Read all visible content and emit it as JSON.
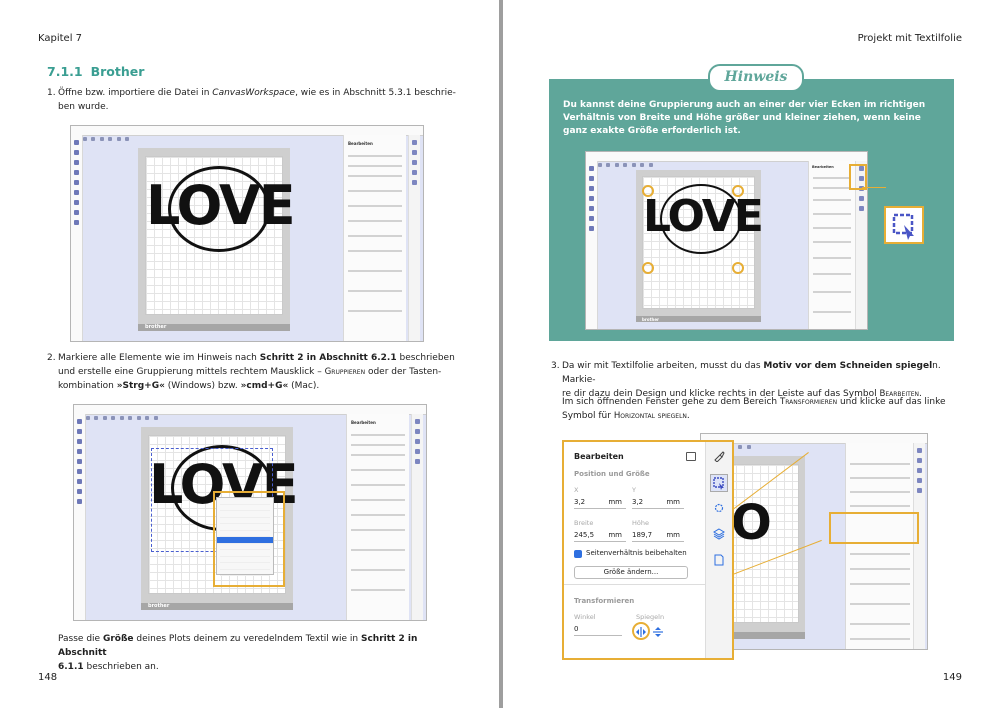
{
  "left_page": {
    "running_head": "Kapitel 7",
    "folio": "148",
    "section_number": "7.1.1",
    "section_title": "Brother",
    "step1": {
      "number": "1.",
      "text_a": "Öffne bzw. importiere die Datei in ",
      "text_italic": "CanvasWorkspace",
      "text_b": ", wie es in Abschnitt 5.3.1 beschrie-",
      "text_c": "ben wurde."
    },
    "step2": {
      "number": "2.",
      "line1_a": "Markiere alle Elemente wie im Hinweis nach ",
      "line1_bold": "Schritt 2 in Abschnitt 6.2.1",
      "line1_b": " beschrieben",
      "line2_a": "und erstelle eine Gruppierung mittels rechtem Mausklick – ",
      "line2_sc": "Gruppieren",
      "line2_b": " oder der Tasten-",
      "line3_a": "kombination ",
      "line3_bold1": "»Strg+G«",
      "line3_b": " (Windows) bzw. ",
      "line3_bold2": "»cmd+G«",
      "line3_c": " (Mac)."
    },
    "closing": {
      "line1_a": "Passe die ",
      "line1_bold1": "Größe",
      "line1_b": " deines Plots deinem zu veredelndem Textil wie in ",
      "line1_bold2": "Schritt 2 in Abschnitt",
      "line2_bold": "6.1.1",
      "line2_b": " beschrieben an."
    },
    "screenshot1": {
      "design_text": "LOVE",
      "mat_brand": "brother",
      "panel_title": "Bearbeiten"
    },
    "screenshot2": {
      "design_text": "LOVE",
      "mat_brand": "brother",
      "panel_title": "Bearbeiten"
    }
  },
  "right_page": {
    "running_head": "Projekt mit Textilfolie",
    "folio": "149",
    "hint": {
      "badge": "Hinweis",
      "text": "Du kannst deine Gruppierung auch an einer der vier Ecken im richtigen Verhältnis von Breite und Höhe größer und kleiner ziehen, wenn keine ganz exakte Größe erforderlich ist.",
      "screenshot": {
        "design_text": "LOVE",
        "mat_brand": "brother",
        "panel_title": "Bearbeiten"
      }
    },
    "step3": {
      "number": "3.",
      "p1_a": "Da wir mit Textilfolie arbeiten, musst du das ",
      "p1_bold": "Motiv vor dem Schneiden spiegel",
      "p1_b": "n. Markie-",
      "p1_line2_a": "re dir dazu dein Design und klicke rechts in der Leiste auf das Symbol ",
      "p1_line2_sc": "Bearbeiten",
      "p1_line2_b": ".",
      "p2_a": "Im sich öffnenden Fenster gehe zu dem Bereich ",
      "p2_sc1": "Transformieren",
      "p2_b": " und klicke auf das linke",
      "p2_line2_a": "Symbol für ",
      "p2_line2_sc": "Horizontal spiegeln",
      "p2_line2_b": "."
    },
    "edit_panel": {
      "title": "Bearbeiten",
      "position_size": "Position und Größe",
      "x_label": "X",
      "y_label": "Y",
      "x_value": "3,2",
      "y_value": "3,2",
      "unit": "mm",
      "width_label": "Breite",
      "height_label": "Höhe",
      "width_value": "245,5",
      "height_value": "189,7",
      "keep_ratio": "Seitenverhältnis beibehalten",
      "resize_button": "Größe ändern...",
      "transform": "Transformieren",
      "angle_label": "Winkel",
      "mirror_label": "Spiegeln",
      "angle_value": "0"
    }
  },
  "colors": {
    "accent": "#3a9e92",
    "hint_bg": "#5fa69a",
    "highlight": "#e7ae35",
    "canvas": "#dfe3f5"
  }
}
